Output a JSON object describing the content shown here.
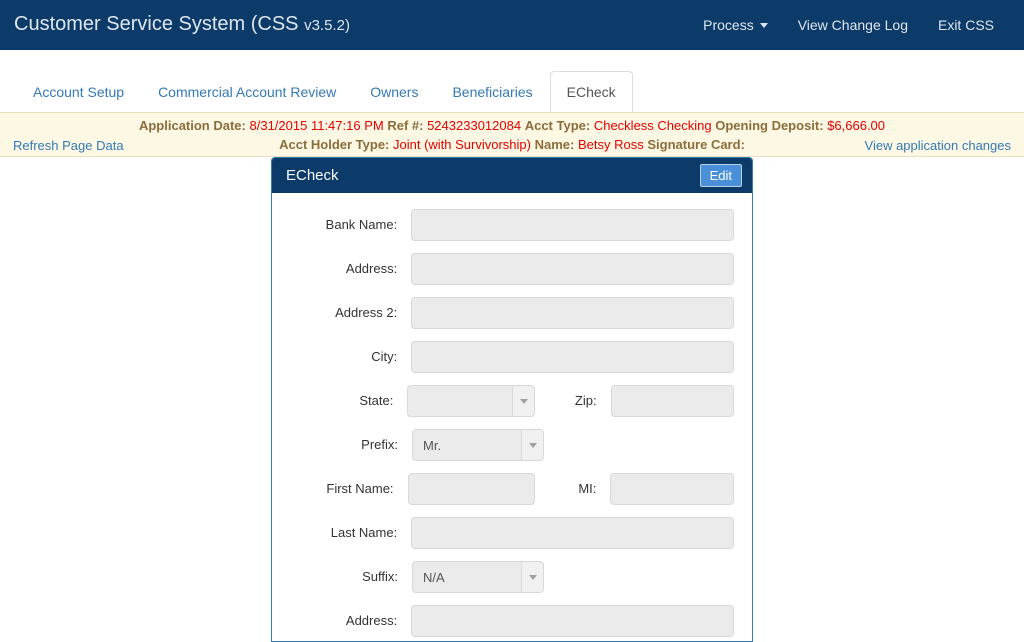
{
  "navbar": {
    "brand_name": "Customer Service System (CSS ",
    "brand_version": "v3.5.2)",
    "links": [
      {
        "label": "Process",
        "has_caret": true
      },
      {
        "label": "View Change Log",
        "has_caret": false
      },
      {
        "label": "Exit CSS",
        "has_caret": false
      }
    ]
  },
  "tabs": [
    {
      "label": "Account Setup",
      "active": false
    },
    {
      "label": "Commercial Account Review",
      "active": false
    },
    {
      "label": "Owners",
      "active": false
    },
    {
      "label": "Beneficiaries",
      "active": false
    },
    {
      "label": "ECheck",
      "active": true
    }
  ],
  "banner": {
    "row1": [
      {
        "label": "Application Date",
        "value": "8/31/2015 11:47:16 PM"
      },
      {
        "label": "Ref #",
        "value": "5243233012084"
      },
      {
        "label": "Acct Type",
        "value": "Checkless Checking"
      },
      {
        "label": "Opening Deposit",
        "value": "$6,666.00"
      }
    ],
    "row2": [
      {
        "label": "Acct Holder Type",
        "value": "Joint (with Survivorship)"
      },
      {
        "label": "Name",
        "value": "Betsy Ross"
      },
      {
        "label": "Signature Card",
        "value": ""
      }
    ],
    "refresh_link": "Refresh Page Data",
    "changes_link": "View application changes"
  },
  "panel": {
    "title": "ECheck",
    "edit_button": "Edit",
    "fields": [
      {
        "label": "Bank Name:",
        "type": "text",
        "value": "",
        "size": "wide"
      },
      {
        "label": "Address:",
        "type": "text",
        "value": "",
        "size": "wide"
      },
      {
        "label": "Address 2:",
        "type": "text",
        "value": "",
        "size": "wide"
      },
      {
        "label": "City:",
        "type": "text",
        "value": "",
        "size": "wide"
      }
    ],
    "state_row": {
      "state_label": "State:",
      "state_value": "",
      "zip_label": "Zip:",
      "zip_value": ""
    },
    "prefix_row": {
      "label": "Prefix:",
      "value": "Mr."
    },
    "name_row": {
      "first_label": "First Name:",
      "first_value": "",
      "mi_label": "MI:",
      "mi_value": ""
    },
    "last_name_row": {
      "label": "Last Name:",
      "value": ""
    },
    "suffix_row": {
      "label": "Suffix:",
      "value": "N/A"
    },
    "bottom_row": {
      "label": "Address:",
      "value": ""
    }
  },
  "colors": {
    "navy": "#0c3b69",
    "link_blue": "#337ab7",
    "banner_bg": "#fcf8e3",
    "banner_label": "#8a6d3b",
    "banner_value": "#e60000",
    "edit_blue": "#4a90d9",
    "disabled_field": "#ebebeb"
  }
}
